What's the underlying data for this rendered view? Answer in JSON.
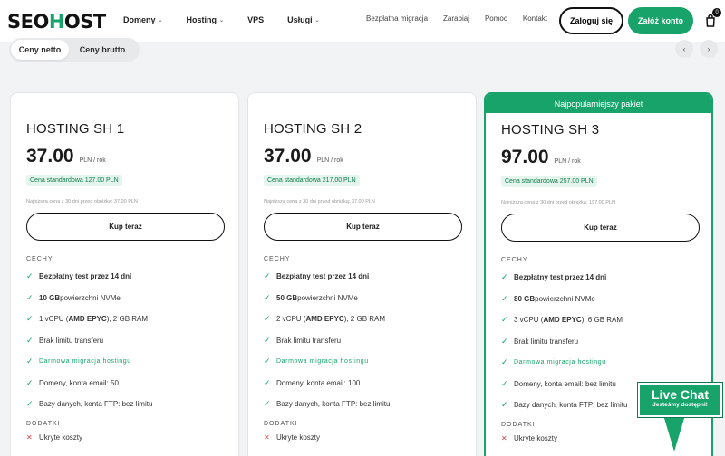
{
  "brand": {
    "logo_left": "SEO",
    "logo_mid": "H",
    "logo_right": "OST"
  },
  "nav": {
    "main": [
      {
        "label": "Domeny",
        "has_dropdown": true
      },
      {
        "label": "Hosting",
        "has_dropdown": true
      },
      {
        "label": "VPS",
        "has_dropdown": false
      },
      {
        "label": "Usługi",
        "has_dropdown": true
      }
    ],
    "secondary": [
      "Bezpłatna migracja",
      "Zarabiaj",
      "Pomoc",
      "Kontakt"
    ],
    "login_label": "Zaloguj się",
    "register_label": "Załóż konto",
    "cart_count": "0"
  },
  "toggle": {
    "netto": "Ceny netto",
    "brutto": "Ceny brutto"
  },
  "carousel": {
    "prev": "‹",
    "next": "›"
  },
  "cards": [
    {
      "title": "HOSTING SH 1",
      "price": "37.00",
      "period": "PLN / rok",
      "standard": "Cena standardowa 127.00 PLN",
      "lowest": "Najniższa cena z 30 dni przed obniżką: 37.00 PLN",
      "buy": "Kup teraz",
      "features_heading": "CECHY",
      "features": [
        {
          "bold": "Bezpłatny test przez 14 dni",
          "rest": ""
        },
        {
          "bold": "10 GB",
          "rest": " powierzchni NVMe"
        },
        {
          "pre": "1 vCPU (",
          "bold": "AMD EPYC",
          "rest": "), 2 GB RAM"
        },
        {
          "bold": "",
          "rest": "Brak limitu transferu"
        },
        {
          "green": "Darmowa migracja hostingu"
        },
        {
          "bold": "",
          "rest": "Domeny, konta email: 50"
        },
        {
          "bold": "",
          "rest": "Bazy danych, konta FTP: bez limitu"
        }
      ],
      "extras_heading": "DODATKI",
      "extras": [
        "Ukryte koszty"
      ]
    },
    {
      "title": "HOSTING SH 2",
      "price": "37.00",
      "period": "PLN / rok",
      "standard": "Cena standardowa 217.00 PLN",
      "lowest": "Najniższa cena z 30 dni przed obniżką: 37.00 PLN",
      "buy": "Kup teraz",
      "features_heading": "CECHY",
      "features": [
        {
          "bold": "Bezpłatny test przez 14 dni",
          "rest": ""
        },
        {
          "bold": "50 GB",
          "rest": " powierzchni NVMe"
        },
        {
          "pre": "2 vCPU (",
          "bold": "AMD EPYC",
          "rest": "), 2 GB RAM"
        },
        {
          "bold": "",
          "rest": "Brak limitu transferu"
        },
        {
          "green": "Darmowa migracja hostingu"
        },
        {
          "bold": "",
          "rest": "Domeny, konta email: 100"
        },
        {
          "bold": "",
          "rest": "Bazy danych, konta FTP: bez limitu"
        }
      ],
      "extras_heading": "DODATKI",
      "extras": [
        "Ukryte koszty"
      ]
    },
    {
      "badge": "Najpopularniejszy pakiet",
      "title": "HOSTING SH 3",
      "price": "97.00",
      "period": "PLN / rok",
      "standard": "Cena standardowa 257.00 PLN",
      "lowest": "Najniższa cena z 30 dni przed obniżką: 197.00 PLN",
      "buy": "Kup teraz",
      "features_heading": "CECHY",
      "features": [
        {
          "bold": "Bezpłatny test przez 14 dni",
          "rest": ""
        },
        {
          "bold": "80 GB",
          "rest": " powierzchni NVMe"
        },
        {
          "pre": "3 vCPU (",
          "bold": "AMD EPYC",
          "rest": "), 6 GB RAM"
        },
        {
          "bold": "",
          "rest": "Brak limitu transferu"
        },
        {
          "green": "Darmowa migracja hostingu"
        },
        {
          "bold": "",
          "rest": "Domeny, konta email: bez limitu"
        },
        {
          "bold": "",
          "rest": "Bazy danych, konta FTP: bez limitu"
        }
      ],
      "extras_heading": "DODATKI",
      "extras": [
        "Ukryte koszty"
      ]
    }
  ],
  "livechat": {
    "title": "Live Chat",
    "subtitle": "Jesteśmy dostępni!"
  },
  "colors": {
    "accent": "#17a36a",
    "cross": "#d64545"
  }
}
